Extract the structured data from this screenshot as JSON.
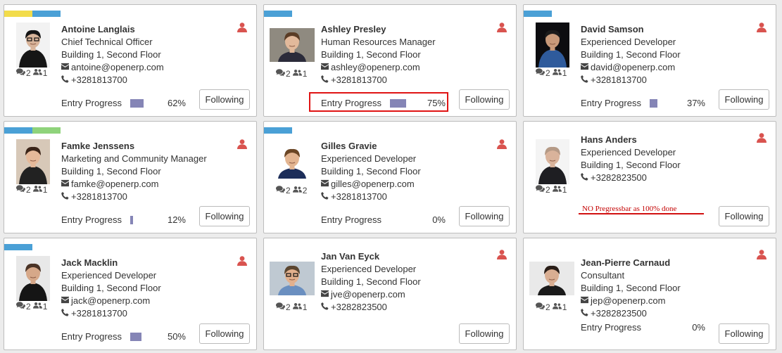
{
  "colors": {
    "tag_yellow": "#f2dc4b",
    "tag_blue": "#4aa0d6",
    "tag_green": "#8fd37b",
    "progress": "#8585b6",
    "person_icon": "#d9534f",
    "annotation_red": "#e01414"
  },
  "icons": {
    "messages": "comments-icon",
    "followers": "users-icon",
    "email": "envelope-icon",
    "phone": "phone-icon",
    "user": "user-icon"
  },
  "employees": [
    {
      "name": "Antoine Langlais",
      "job": "Chief Technical Officer",
      "location": "Building 1, Second Floor",
      "email": "antoine@openerp.com",
      "phone": "+3281813700",
      "messages": "2",
      "followers": "1",
      "progress_label": "Entry Progress",
      "progress": 0.62,
      "progress_text": "62%",
      "button": "Following",
      "tags": [
        "yellow",
        "blue"
      ]
    },
    {
      "name": "Ashley Presley",
      "job": "Human Resources Manager",
      "location": "Building 1, Second Floor",
      "email": "ashley@openerp.com",
      "phone": "+3281813700",
      "messages": "2",
      "followers": "1",
      "progress_label": "Entry Progress",
      "progress": 0.75,
      "progress_text": "75%",
      "button": "Following",
      "tags": [
        "blue"
      ]
    },
    {
      "name": "David Samson",
      "job": "Experienced Developer",
      "location": "Building 1, Second Floor",
      "email": "david@openerp.com",
      "phone": "+3281813700",
      "messages": "2",
      "followers": "1",
      "progress_label": "Entry Progress",
      "progress": 0.37,
      "progress_text": "37%",
      "button": "Following",
      "tags": [
        "blue"
      ]
    },
    {
      "name": "Famke Jenssens",
      "job": "Marketing and Community Manager",
      "location": "Building 1, Second Floor",
      "email": "famke@openerp.com",
      "phone": "+3281813700",
      "messages": "2",
      "followers": "1",
      "progress_label": "Entry Progress",
      "progress": 0.12,
      "progress_text": "12%",
      "button": "Following",
      "tags": [
        "blue",
        "green"
      ]
    },
    {
      "name": "Gilles Gravie",
      "job": "Experienced Developer",
      "location": "Building 1, Second Floor",
      "email": "gilles@openerp.com",
      "phone": "+3281813700",
      "messages": "2",
      "followers": "2",
      "progress_label": "Entry Progress",
      "progress": 0,
      "progress_text": "0%",
      "button": "Following",
      "tags": [
        "blue"
      ]
    },
    {
      "name": "Hans Anders",
      "job": "Experienced Developer",
      "location": "Building 1, Second Floor",
      "phone": "+3282823500",
      "messages": "2",
      "followers": "1",
      "note": "NO Pregressbar as 100% done",
      "button": "Following",
      "tags": []
    },
    {
      "name": "Jack Macklin",
      "job": "Experienced Developer",
      "location": "Building 1, Second Floor",
      "email": "jack@openerp.com",
      "phone": "+3281813700",
      "messages": "2",
      "followers": "1",
      "progress_label": "Entry Progress",
      "progress": 0.5,
      "progress_text": "50%",
      "button": "Following",
      "tags": [
        "blue"
      ]
    },
    {
      "name": "Jan Van Eyck",
      "job": "Experienced Developer",
      "location": "Building 1, Second Floor",
      "email": "jve@openerp.com",
      "phone": "+3282823500",
      "messages": "2",
      "followers": "1",
      "button": "Following",
      "tags": []
    },
    {
      "name": "Jean-Pierre Carnaud",
      "job": "Consultant",
      "location": "Building 1, Second Floor",
      "email": "jep@openerp.com",
      "phone": "+3282823500",
      "messages": "2",
      "followers": "1",
      "progress_label": "Entry Progress",
      "progress": 0,
      "progress_text": "0%",
      "button": "Following",
      "tags": []
    }
  ]
}
